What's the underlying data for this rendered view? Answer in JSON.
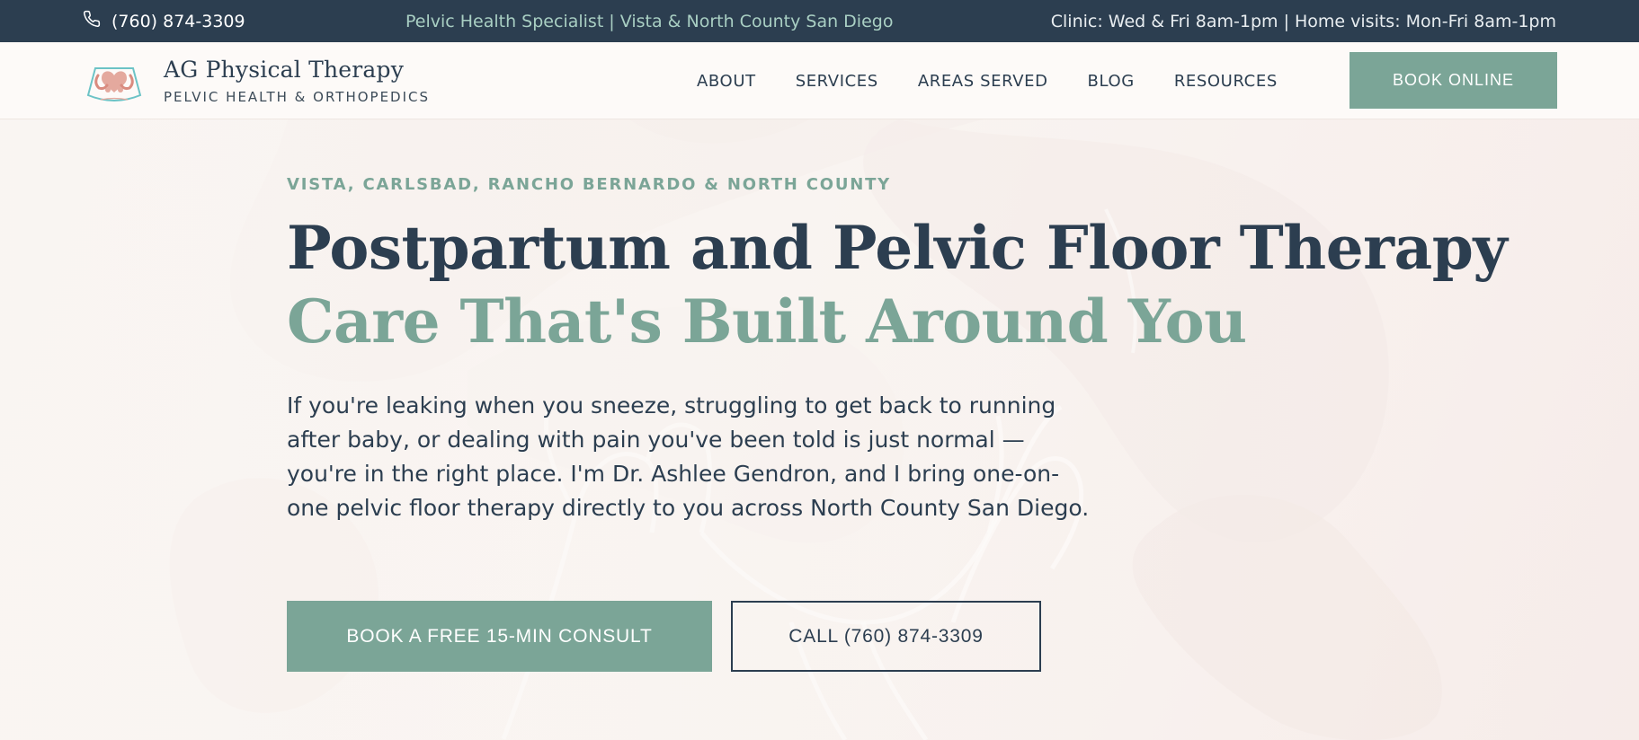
{
  "topbar": {
    "phone": "(760) 874-3309",
    "tagline": "Pelvic Health Specialist | Vista & North County San Diego",
    "hours": "Clinic: Wed & Fri 8am-1pm | Home visits: Mon-Fri 8am-1pm"
  },
  "header": {
    "brand_name": "AG Physical Therapy",
    "brand_sub": "PELVIC HEALTH & ORTHOPEDICS",
    "nav": [
      "ABOUT",
      "SERVICES",
      "AREAS SERVED",
      "BLOG",
      "RESOURCES"
    ],
    "book_label": "BOOK ONLINE"
  },
  "hero": {
    "eyebrow": "VISTA, CARLSBAD, RANCHO BERNARDO & NORTH COUNTY",
    "headline_line1": "Postpartum and Pelvic Floor Therapy",
    "headline_line2": "Care That's Built Around You",
    "lead": "If you're leaking when you sneeze, struggling to get back to running after baby, or dealing with pain you've been told is just normal — you're in the right place. I'm Dr. Ashlee Gendron, and I bring one-on-one pelvic floor therapy directly to you across North County San Diego.",
    "cta_primary": "BOOK A FREE 15-MIN CONSULT",
    "cta_secondary": "CALL (760) 874-3309"
  },
  "colors": {
    "navy": "#2c3e50",
    "sage": "#7ba597",
    "background": "#fbf7f4"
  },
  "icons": {
    "phone": "phone-icon",
    "logo": "pelvis-heart-logo-icon"
  }
}
